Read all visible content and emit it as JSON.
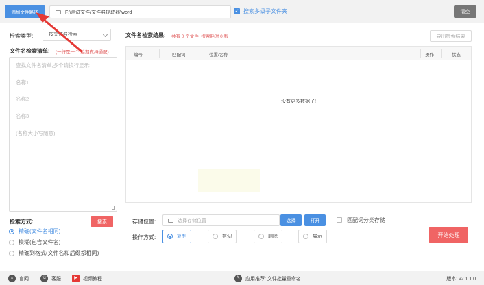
{
  "topbar": {
    "add_path_label": "添加文件路径",
    "path_value": "F:\\测试文件\\文件名提取器\\word",
    "include_subfolders_label": "搜索多级子文件夹",
    "clear_label": "清空"
  },
  "left": {
    "search_type_label": "检索类型:",
    "search_type_value": "按文件名检索",
    "list_label": "文件名检索清单:",
    "list_hint": "(一行是一个,后期支持通配)",
    "list_placeholder_lines": [
      "查找文件名清单,多个请换行显示:",
      "名称1",
      "名称2",
      "名称3",
      "(名称大小写随意)"
    ],
    "mode_label": "检索方式:",
    "search_button": "搜索",
    "modes": [
      {
        "label": "精确(文件名相同)",
        "selected": true
      },
      {
        "label": "模糊(包含文件名)",
        "selected": false
      },
      {
        "label": "精确到格式(文件名和后缀都相同)",
        "selected": false
      }
    ]
  },
  "right": {
    "result_label": "文件名检索结果:",
    "result_stats": "共有 0 个文件, 搜索耗时 0 秒",
    "export_label": "导出检索结果",
    "columns": [
      "编号",
      "匹配词",
      "位置/名称",
      "操作",
      "状态"
    ],
    "empty_message": "没有更多数据了!",
    "save_label": "存储位置:",
    "save_placeholder": "选择存储位置",
    "choose_label": "选择",
    "open_label": "打开",
    "match_classify_label": "匹配词分类存储",
    "operation_label": "操作方式:",
    "operations": [
      {
        "label": "复制",
        "selected": true
      },
      {
        "label": "剪切",
        "selected": false
      },
      {
        "label": "删除",
        "selected": false
      },
      {
        "label": "展示",
        "selected": false
      }
    ],
    "start_label": "开始处理"
  },
  "statusbar": {
    "website_label": "官网",
    "service_label": "客服",
    "video_label": "视频教程",
    "recommend_label": "应用推荐: 文件批量重命名",
    "version": "版本: v2.1.1.0"
  },
  "colors": {
    "primary": "#4a90e2",
    "danger": "#f06464",
    "arrow": "#e53935"
  }
}
